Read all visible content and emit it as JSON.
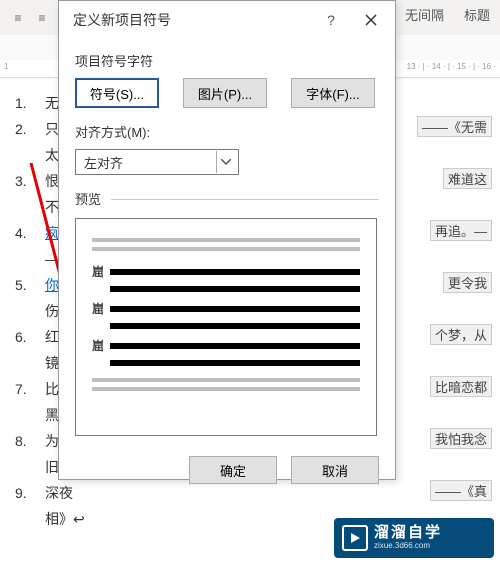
{
  "ribbon": {
    "style1": "无间隔",
    "style2": "标题"
  },
  "ruler": {
    "left": "1",
    "right": "13 · | · 14 · | · 15 · | · 16 ·"
  },
  "doc": {
    "lines": [
      {
        "num": "1.",
        "text": "无需",
        "frag": ""
      },
      {
        "num": "2.",
        "text": "只想",
        "frag": "——《无需"
      },
      {
        "num": "",
        "text": "太多》↩",
        "frag": ""
      },
      {
        "num": "3.",
        "text": "恨爱",
        "frag": "难道这"
      },
      {
        "num": "",
        "text": "不算，相",
        "frag": ""
      },
      {
        "num": "4.",
        "text": "疯狂",
        "link": true,
        "frag": "再追。—"
      },
      {
        "num": "",
        "text": "—《追》",
        "frag": ""
      },
      {
        "num": "5.",
        "text": "你仍",
        "link": true,
        "frag": "更令我"
      },
      {
        "num": "",
        "text": "伤悲。—",
        "frag": ""
      },
      {
        "num": "6.",
        "text": "红像",
        "frag": "个梦，从"
      },
      {
        "num": "",
        "text": "镜里看不",
        "frag": ""
      },
      {
        "num": "7.",
        "text": "比引",
        "frag": "比暗恋都"
      },
      {
        "num": "",
        "text": "黑暗，比",
        "frag": ""
      },
      {
        "num": "8.",
        "text": "为爱",
        "frag": "我怕我念"
      },
      {
        "num": "",
        "text": "旧。——",
        "frag": ""
      },
      {
        "num": "9.",
        "text": "深夜",
        "frag": "——《真"
      },
      {
        "num": "",
        "text": "相》↩",
        "frag": ""
      }
    ]
  },
  "dialog": {
    "title": "定义新项目符号",
    "section_char": "项目符号字符",
    "btn_symbol": "符号(S)...",
    "btn_picture": "图片(P)...",
    "btn_font": "字体(F)...",
    "align_label": "对齐方式(M):",
    "align_value": "左对齐",
    "preview_label": "预览",
    "bullet_char": "崫",
    "ok": "确定",
    "cancel": "取消"
  },
  "watermark": {
    "brand": "溜溜自学",
    "url": "zixue.3d66.com"
  }
}
